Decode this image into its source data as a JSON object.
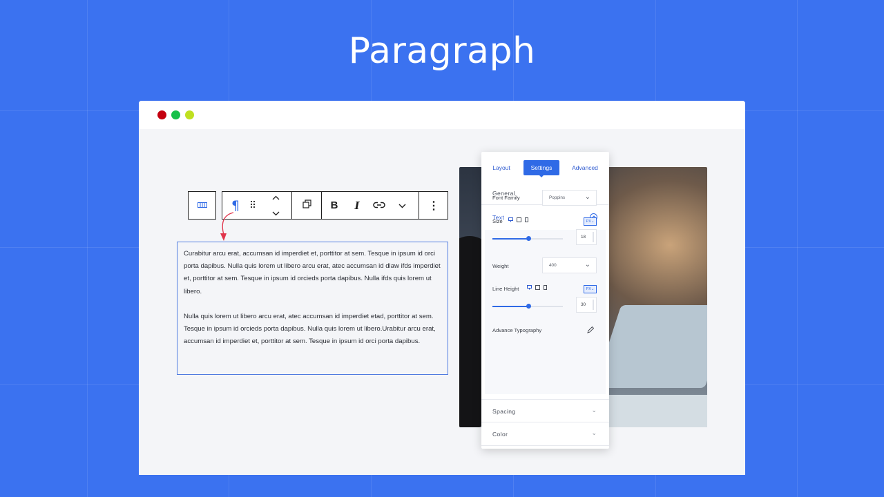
{
  "page": {
    "title": "Paragraph",
    "background_color": "#3b72f0"
  },
  "window": {
    "traffic_lights": [
      {
        "name": "close",
        "color": "#c4000f"
      },
      {
        "name": "minimize",
        "color": "#17c04a"
      },
      {
        "name": "maximize",
        "color": "#bfe01f"
      }
    ]
  },
  "toolbar": {
    "icons": [
      "columns-icon",
      "paragraph-icon",
      "drag-handle-icon",
      "move-up-icon",
      "move-down-icon",
      "duplicate-icon",
      "bold-icon",
      "italic-icon",
      "link-icon",
      "more-rich-text-chevron-icon",
      "options-kebab-icon"
    ],
    "paragraph_glyph": "¶",
    "bold_glyph": "B",
    "italic_glyph": "I",
    "kebab_glyph": "⋮"
  },
  "paragraph_block": {
    "paragraphs": [
      "Curabitur arcu erat, accumsan id imperdiet et, porttitor at sem. Tesque in ipsum id orci porta dapibus. Nulla quis lorem ut libero arcu erat, atec accumsan id dlaw ifds imperdiet et, porttitor at sem. Tesque in ipsum id orcieds porta dapibus. Nulla ifds quis lorem ut libero.",
      "Nulla quis lorem ut libero arcu erat, atec accumsan id imperdiet etad, porttitor at sem. Tesque in ipsum id orcieds porta dapibus. Nulla quis lorem ut libero.Urabitur arcu erat, accumsan id imperdiet et, porttitor at sem. Tesque in ipsum id orci porta dapibus."
    ]
  },
  "settings_panel": {
    "tabs": [
      {
        "label": "Layout",
        "active": false
      },
      {
        "label": "Settings",
        "active": true
      },
      {
        "label": "Advanced",
        "active": false
      }
    ],
    "sections": {
      "general": "General",
      "text": "Text",
      "spacing": "Spacing",
      "color": "Color"
    },
    "text_settings": {
      "font_family_label": "Font Family",
      "font_family_value": "Poppins",
      "size_label": "Size",
      "size_unit": "PX",
      "size_value": "18",
      "size_slider_fraction": 0.51,
      "weight_label": "Weight",
      "weight_value": "400",
      "line_height_label": "Line Height",
      "line_height_unit": "PX",
      "line_height_value": "30",
      "line_height_slider_fraction": 0.51,
      "advance_typography_label": "Advance Typography",
      "device_icons": [
        "desktop-icon",
        "tablet-icon",
        "mobile-icon"
      ]
    },
    "accent_color": "#2f6ae6"
  }
}
